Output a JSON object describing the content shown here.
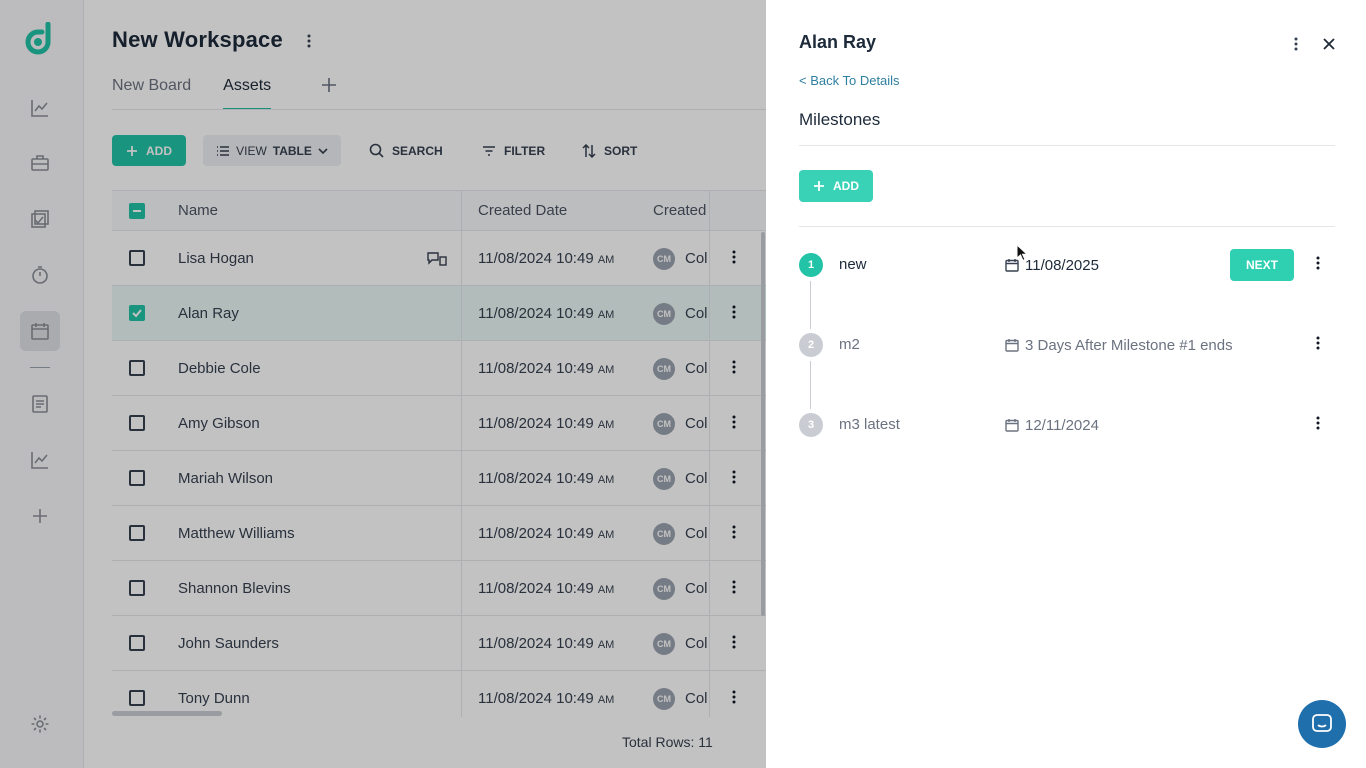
{
  "sidebar": {
    "logo_icon": "d-logo-icon",
    "items": [
      {
        "name": "analytics",
        "icon": "line-chart-icon"
      },
      {
        "name": "briefcase",
        "icon": "briefcase-icon"
      },
      {
        "name": "tasks",
        "icon": "checklist-icon"
      },
      {
        "name": "timer",
        "icon": "stopwatch-icon"
      },
      {
        "name": "calendar",
        "icon": "calendar-icon",
        "active": true
      },
      {
        "name": "documents",
        "icon": "document-icon"
      },
      {
        "name": "reports",
        "icon": "line-chart-icon"
      },
      {
        "name": "add",
        "icon": "plus-icon"
      },
      {
        "name": "settings",
        "icon": "gear-icon"
      }
    ]
  },
  "workspace": {
    "title": "New Workspace",
    "tabs": [
      {
        "label": "New Board",
        "active": false
      },
      {
        "label": "Assets",
        "active": true
      }
    ]
  },
  "toolbar": {
    "add_label": "ADD",
    "view_prefix": "VIEW",
    "view_value": "TABLE",
    "search_label": "SEARCH",
    "filter_label": "FILTER",
    "sort_label": "SORT"
  },
  "table": {
    "columns": [
      "Name",
      "Created Date",
      "Created"
    ],
    "rows": [
      {
        "name": "Lisa Hogan",
        "date": "11/08/2024 10:49",
        "ampm": "AM",
        "initials": "CM",
        "creator": "Col",
        "checked": false
      },
      {
        "name": "Alan Ray",
        "date": "11/08/2024 10:49",
        "ampm": "AM",
        "initials": "CM",
        "creator": "Col",
        "checked": true
      },
      {
        "name": "Debbie Cole",
        "date": "11/08/2024 10:49",
        "ampm": "AM",
        "initials": "CM",
        "creator": "Col",
        "checked": false
      },
      {
        "name": "Amy Gibson",
        "date": "11/08/2024 10:49",
        "ampm": "AM",
        "initials": "CM",
        "creator": "Col",
        "checked": false
      },
      {
        "name": "Mariah Wilson",
        "date": "11/08/2024 10:49",
        "ampm": "AM",
        "initials": "CM",
        "creator": "Col",
        "checked": false
      },
      {
        "name": "Matthew Williams",
        "date": "11/08/2024 10:49",
        "ampm": "AM",
        "initials": "CM",
        "creator": "Col",
        "checked": false
      },
      {
        "name": "Shannon Blevins",
        "date": "11/08/2024 10:49",
        "ampm": "AM",
        "initials": "CM",
        "creator": "Col",
        "checked": false
      },
      {
        "name": "John Saunders",
        "date": "11/08/2024 10:49",
        "ampm": "AM",
        "initials": "CM",
        "creator": "Col",
        "checked": false
      },
      {
        "name": "Tony Dunn",
        "date": "11/08/2024 10:49",
        "ampm": "AM",
        "initials": "CM",
        "creator": "Col",
        "checked": false
      }
    ],
    "total_rows": "Total Rows: 11"
  },
  "drawer": {
    "title": "Alan Ray",
    "back_label": "< Back To Details",
    "section_title": "Milestones",
    "add_label": "ADD",
    "milestones": [
      {
        "number": "1",
        "name": "new",
        "date": "11/08/2025",
        "status": "active",
        "next_label": "NEXT"
      },
      {
        "number": "2",
        "name": "m2",
        "date": "3 Days After Milestone #1 ends",
        "status": "pending"
      },
      {
        "number": "3",
        "name": "m3 latest",
        "date": "12/11/2024",
        "status": "pending"
      }
    ]
  },
  "colors": {
    "accent": "#22c3a6",
    "chat_button": "#1f6fad",
    "link": "#2f7fa0"
  }
}
